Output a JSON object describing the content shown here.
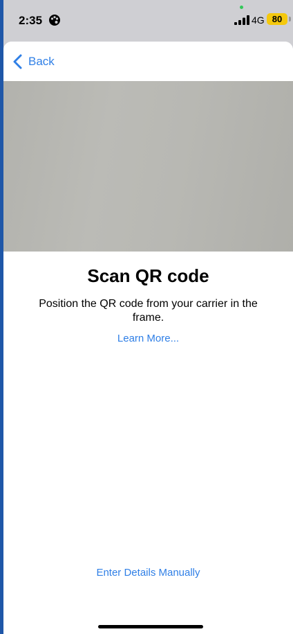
{
  "status_bar": {
    "time": "2:35",
    "time_icon": "palette-icon",
    "signal_icon": "cellular-signal-icon",
    "network": "4G",
    "battery": "80",
    "battery_color": "#f4c80c"
  },
  "nav": {
    "back_label": "Back",
    "back_icon": "chevron-left-icon"
  },
  "content": {
    "title": "Scan QR code",
    "subtitle": "Position the QR code from your carrier in the frame.",
    "learn_more": "Learn More...",
    "enter_manually": "Enter Details Manually"
  },
  "colors": {
    "accent": "#2f7fe6",
    "status_bg": "#cfcfd3"
  }
}
